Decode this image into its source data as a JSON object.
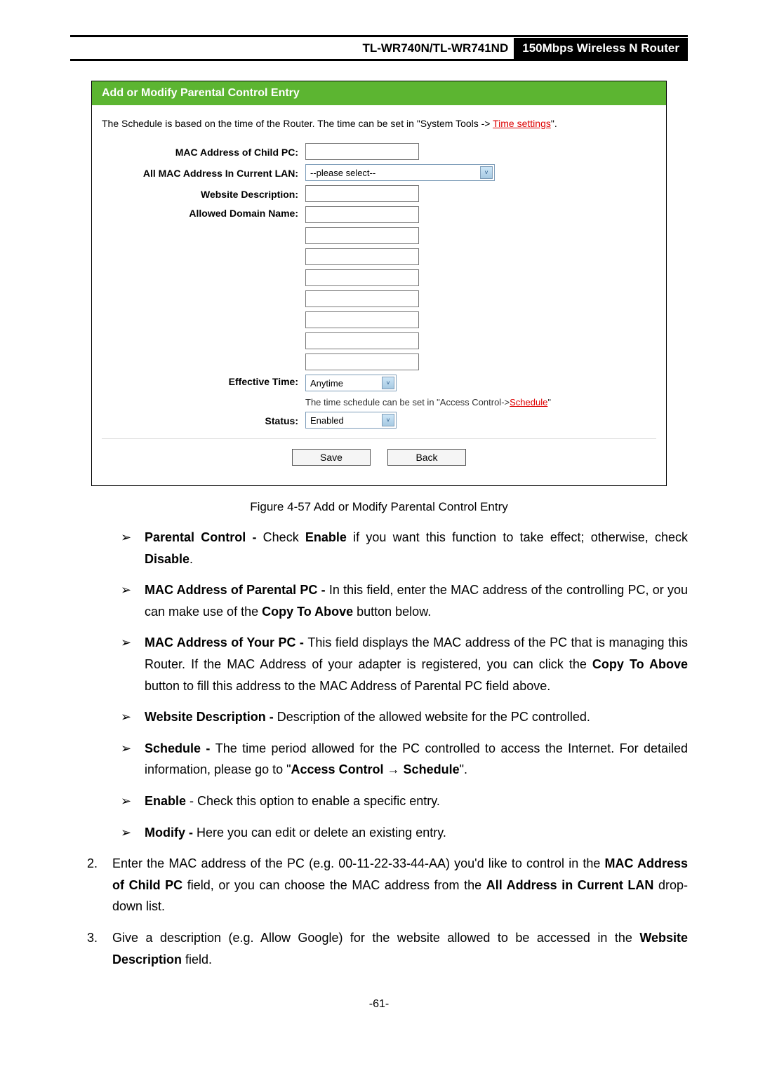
{
  "header": {
    "left": "TL-WR740N/TL-WR741ND",
    "right": "150Mbps Wireless N Router"
  },
  "figure": {
    "title": "Add or Modify Parental Control Entry",
    "schedule_note_pre": "The Schedule is based on the time of the Router. The time can be set in \"System Tools -> ",
    "schedule_note_link": "Time settings",
    "schedule_note_post": "\".",
    "labels": {
      "mac_child": "MAC Address of Child PC:",
      "all_mac": "All MAC Address In Current LAN:",
      "website_desc": "Website Description:",
      "allowed_domain": "Allowed Domain Name:",
      "effective_time": "Effective Time:",
      "status": "Status:"
    },
    "values": {
      "all_mac_select": "--please select--",
      "effective_time": "Anytime",
      "effective_hint_pre": "The time schedule can be set in \"Access Control->",
      "effective_hint_link": "Schedule",
      "effective_hint_post": "\"",
      "status": "Enabled"
    },
    "buttons": {
      "save": "Save",
      "back": "Back"
    }
  },
  "caption": "Figure 4-57    Add or Modify Parental Control Entry",
  "bullets": {
    "b1_a": "Parental Control - ",
    "b1_b": "Check ",
    "b1_c": "Enable",
    "b1_d": " if you want this function to take effect; otherwise, check ",
    "b1_e": "Disable",
    "b1_f": ".",
    "b2_a": "MAC Address of Parental PC - ",
    "b2_b": "In this field, enter the MAC address of the controlling PC, or you can make use of the ",
    "b2_c": "Copy To Above",
    "b2_d": " button below.",
    "b3_a": "MAC Address of Your PC - ",
    "b3_b": "This field displays the MAC address of the PC that is managing this Router. If the MAC Address of your adapter is registered, you can click the ",
    "b3_c": "Copy To Above",
    "b3_d": " button to fill this address to the MAC Address of Parental PC field above.",
    "b4_a": "Website Description - ",
    "b4_b": "Description of the allowed website for the PC controlled.",
    "b5_a": "Schedule - ",
    "b5_b": "The time period allowed for the PC controlled to access the Internet. For detailed information, please go to \"",
    "b5_c": "Access Control  →  Schedule",
    "b5_d": "\".",
    "b6_a": "Enable",
    "b6_b": " - Check this option to enable a specific entry.",
    "b7_a": "Modify - ",
    "b7_b": "Here you can edit or delete an existing entry."
  },
  "steps": {
    "s2_a": "Enter the MAC address of the PC (e.g. 00-11-22-33-44-AA) you'd like to control in the ",
    "s2_b": "MAC Address of Child PC",
    "s2_c": " field, or you can choose the MAC address from the ",
    "s2_d": "All Address in Current LAN",
    "s2_e": " drop-down list.",
    "s3_a": "Give a description (e.g. Allow Google) for the website allowed to be accessed in the ",
    "s3_b": "Website Description",
    "s3_c": " field."
  },
  "pagenum": "-61-"
}
